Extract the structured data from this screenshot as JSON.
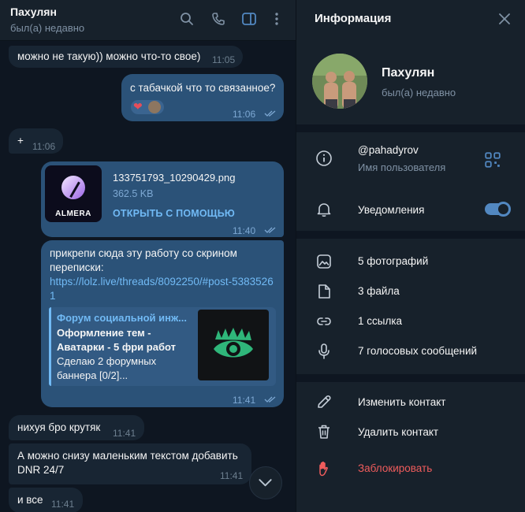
{
  "chat": {
    "header": {
      "name": "Пахулян",
      "status": "был(а) недавно",
      "icons": [
        "search-icon",
        "phone-icon",
        "sidebar-toggle-icon",
        "more-vertical-icon"
      ]
    },
    "messages": [
      {
        "direction": "in",
        "text": "можно не такую)) можно что-то свое)",
        "time": "11:05"
      },
      {
        "direction": "out",
        "text": "с табачкой что то связанное?",
        "time": "11:06",
        "reactions": [
          "heart-reaction",
          "avatar-reaction"
        ]
      },
      {
        "direction": "in",
        "text": "+",
        "time": "11:06"
      },
      {
        "direction": "out",
        "type": "file",
        "file_name": "133751793_10290429.png",
        "file_size": "362.5 KB",
        "action": "ОТКРЫТЬ С ПОМОЩЬЮ",
        "thumb_label": "ALMERA",
        "time": "11:40"
      },
      {
        "direction": "out",
        "text_line1": "прикрепи сюда эту работу со скрином",
        "text_line2": "переписки:",
        "link_line1": "https://lolz.live/threads/8092250/#post-5383526",
        "link_line2": "1",
        "preview": {
          "site": "Форум социальной инж...",
          "title_line1": "Оформление тем -",
          "title_line2": "Аватарки - 5 фри работ",
          "desc_line1": "Сделаю 2 форумных",
          "desc_line2": "баннера [0/2]..."
        },
        "time": "11:41"
      },
      {
        "direction": "in",
        "text": "нихуя бро крутяк",
        "time": "11:41"
      },
      {
        "direction": "in",
        "text_line1": "А можно снизу маленьким текстом добавить",
        "text_line2": "DNR 24/7",
        "time": "11:41"
      },
      {
        "direction": "in",
        "text": "и все",
        "time": "11:41"
      }
    ]
  },
  "info": {
    "title": "Информация",
    "name": "Пахулян",
    "status": "был(а) недавно",
    "username": "@pahadyrov",
    "username_label": "Имя пользователя",
    "notifications_label": "Уведомления",
    "notifications_enabled": true,
    "media": {
      "photos": "5 фотографий",
      "files": "3 файла",
      "links": "1 ссылка",
      "voice": "7 голосовых сообщений"
    },
    "actions": {
      "edit": "Изменить контакт",
      "delete": "Удалить контакт",
      "block": "Заблокировать"
    }
  },
  "colors": {
    "accent": "#5288c1",
    "link": "#71baf5",
    "outgoing_bubble": "#2b5278",
    "incoming_bubble": "#182533",
    "danger": "#ef5c5c"
  }
}
